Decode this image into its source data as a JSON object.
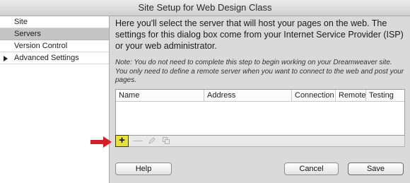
{
  "window": {
    "title": "Site Setup for Web Design Class"
  },
  "sidebar": {
    "items": [
      {
        "label": "Site"
      },
      {
        "label": "Servers"
      },
      {
        "label": "Version Control"
      },
      {
        "label": "Advanced Settings"
      }
    ]
  },
  "main": {
    "intro": "Here you'll select the server that will host your pages on the web. The settings for this dialog box come from your Internet Service Provider (ISP) or your web administrator.",
    "note": "Note: You do not need to complete this step to begin working on your Dreamweaver site. You only need to define a remote server when you want to connect to the web and post your pages."
  },
  "servers_table": {
    "columns": [
      "Name",
      "Address",
      "Connection",
      "Remote",
      "Testing"
    ],
    "rows": []
  },
  "table_toolbar": {
    "add_label": "+",
    "remove_label": "—",
    "edit_icon": "pencil-icon",
    "duplicate_icon": "duplicate-icon"
  },
  "annotation": {
    "arrow_color": "#d41f28",
    "highlight_color": "#e7e23a"
  },
  "buttons": {
    "help": "Help",
    "cancel": "Cancel",
    "save": "Save"
  }
}
